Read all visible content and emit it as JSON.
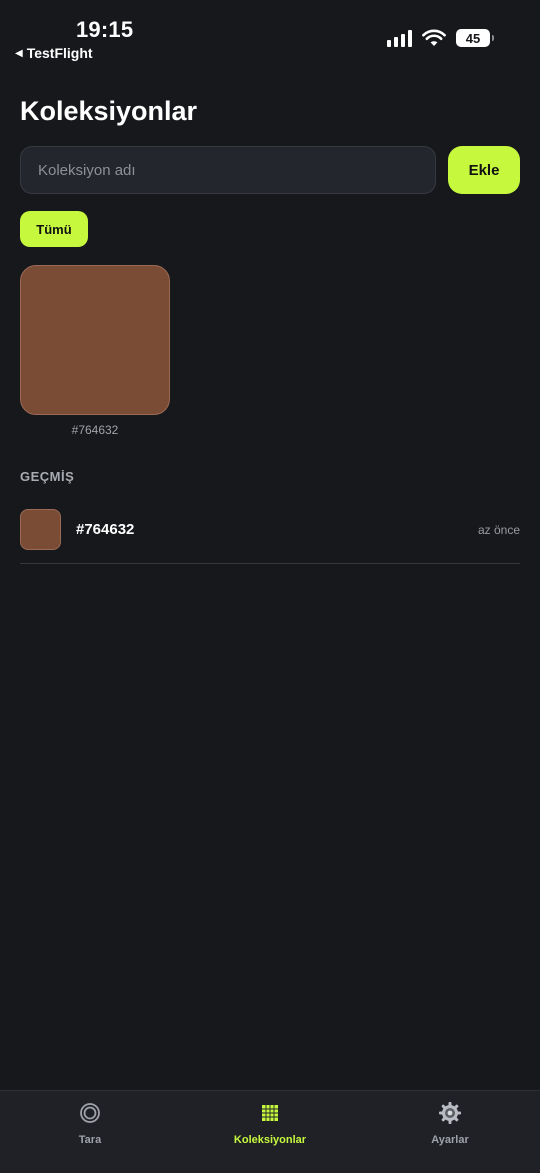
{
  "status_bar": {
    "time": "19:15",
    "back_label": "TestFlight",
    "battery": "45",
    "icons": [
      "cellular-signal-icon",
      "wifi-icon",
      "battery-icon"
    ]
  },
  "page": {
    "title": "Koleksiyonlar"
  },
  "add_form": {
    "placeholder": "Koleksiyon adı",
    "value": "",
    "button_label": "Ekle"
  },
  "filters": {
    "selected": "Tümü"
  },
  "collection": {
    "swatches": [
      {
        "hex": "#764632",
        "color": "#7a4b35"
      }
    ]
  },
  "history": {
    "heading": "GEÇMİŞ",
    "items": [
      {
        "hex": "#764632",
        "color": "#7a4b35",
        "time": "az önce"
      }
    ]
  },
  "tab_bar": {
    "tabs": [
      {
        "label": "Tara",
        "icon": "scan-target-icon",
        "active": false
      },
      {
        "label": "Koleksiyonlar",
        "icon": "grid-icon",
        "active": true
      },
      {
        "label": "Ayarlar",
        "icon": "gear-icon",
        "active": false
      }
    ]
  },
  "colors": {
    "background": "#17181c",
    "accent": "#c6f83e",
    "input_bg": "#23262d",
    "tab_bar_bg": "#1f2126"
  }
}
